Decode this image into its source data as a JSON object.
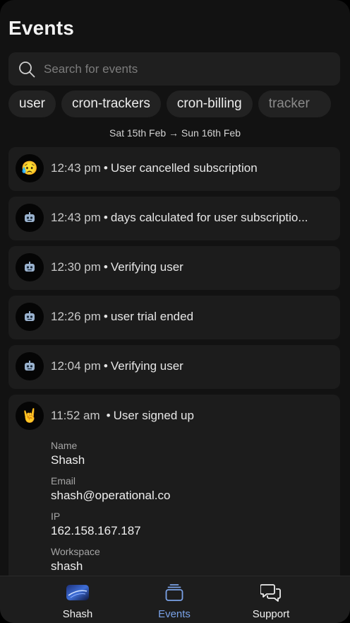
{
  "header": {
    "title": "Events"
  },
  "search": {
    "placeholder": "Search for events",
    "icon": "search-icon"
  },
  "filters": [
    "user",
    "cron-trackers",
    "cron-billing",
    "tracker"
  ],
  "date_range": "Sat 15th Feb → Sun 16th Feb",
  "events": [
    {
      "avatar": "😥",
      "time": "12:43 pm",
      "text": "User cancelled subscription"
    },
    {
      "avatar": "robot-icon",
      "time": "12:43 pm",
      "text": "days calculated for user subscriptio..."
    },
    {
      "avatar": "robot-icon",
      "time": "12:30 pm",
      "text": "Verifying user"
    },
    {
      "avatar": "robot-icon",
      "time": "12:26 pm",
      "text": "user trial ended"
    },
    {
      "avatar": "robot-icon",
      "time": "12:04 pm",
      "text": "Verifying user"
    }
  ],
  "expanded_event": {
    "avatar": "🤘",
    "time": "11:52 am",
    "text": "User signed up",
    "fields": [
      {
        "label": "Name",
        "value": "Shash"
      },
      {
        "label": "Email",
        "value": "shash@operational.co"
      },
      {
        "label": "IP",
        "value": "162.158.167.187"
      },
      {
        "label": "Workspace",
        "value": "shash"
      }
    ]
  },
  "tabs": [
    {
      "label": "Shash",
      "icon": "workspace-avatar-icon"
    },
    {
      "label": "Events",
      "icon": "stack-icon",
      "active": true
    },
    {
      "label": "Support",
      "icon": "chat-bubbles-icon"
    }
  ],
  "colors": {
    "background": "#121212",
    "card": "#1c1c1c",
    "accent": "#7aa2e8"
  }
}
